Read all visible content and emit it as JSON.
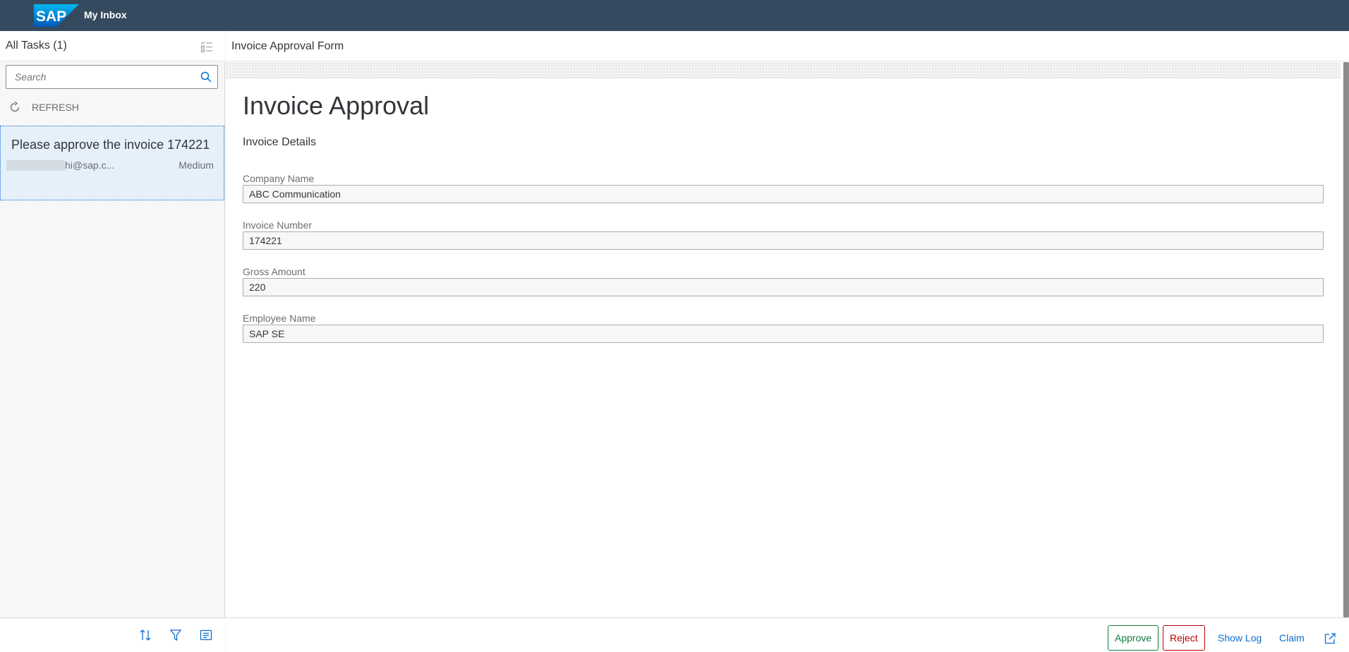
{
  "shell": {
    "logo_text": "SAP",
    "app_title": "My Inbox"
  },
  "master": {
    "title": "All Tasks (1)",
    "search_placeholder": "Search",
    "refresh_label": "REFRESH",
    "tasks": [
      {
        "title": "Please approve the invoice 174221",
        "sender": "hi@sap.c...",
        "priority": "Medium"
      }
    ],
    "footer_icons": [
      "sort-icon",
      "filter-icon",
      "group-icon"
    ]
  },
  "detail": {
    "header_title": "Invoice Approval Form",
    "form_title": "Invoice Approval",
    "section_title": "Invoice Details",
    "fields": [
      {
        "label": "Company Name",
        "value": "ABC Communication"
      },
      {
        "label": "Invoice Number",
        "value": "174221"
      },
      {
        "label": "Gross Amount",
        "value": "220"
      },
      {
        "label": "Employee Name",
        "value": "SAP SE"
      }
    ]
  },
  "actions": {
    "approve": "Approve",
    "reject": "Reject",
    "show_log": "Show Log",
    "claim": "Claim"
  },
  "colors": {
    "shell": "#354a5f",
    "accent": "#0a6ed1",
    "positive": "#107e3e",
    "negative": "#bb0000",
    "selected_item": "#e5f0fa"
  }
}
